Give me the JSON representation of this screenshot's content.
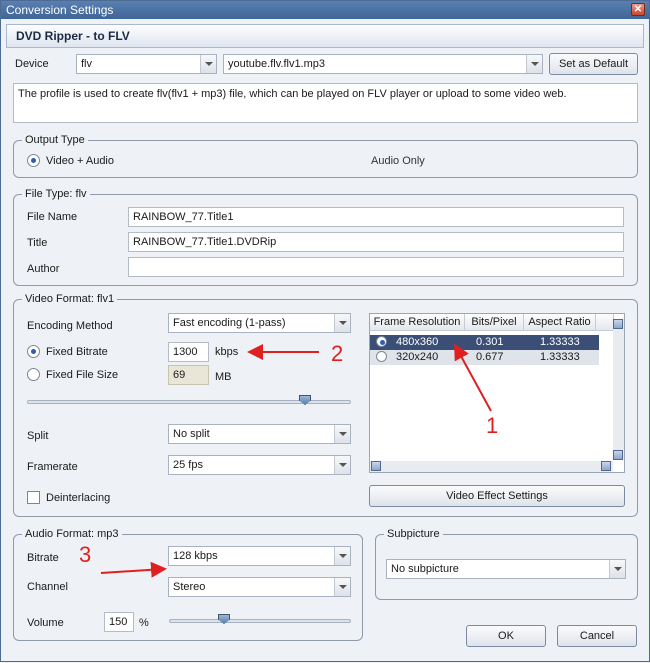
{
  "window": {
    "title": "Conversion Settings",
    "close_glyph": "✕"
  },
  "header": {
    "title": "DVD Ripper - to FLV"
  },
  "device": {
    "label": "Device",
    "device_value": "flv",
    "profile_value": "youtube.flv.flv1.mp3",
    "set_default_label": "Set as Default",
    "description": "The profile is used to create flv(flv1 + mp3) file, which can be played on FLV player or upload to some video web."
  },
  "output_type": {
    "title": "Output Type",
    "video_audio_label": "Video + Audio",
    "audio_only_label": "Audio Only"
  },
  "file_type": {
    "title": "File Type: flv",
    "file_name_label": "File Name",
    "file_name_value": "RAINBOW_77.Title1",
    "title_label": "Title",
    "title_value": "RAINBOW_77.Title1.DVDRip",
    "author_label": "Author",
    "author_value": ""
  },
  "video_format": {
    "title": "Video Format: flv1",
    "encoding_label": "Encoding Method",
    "encoding_value": "Fast encoding (1-pass)",
    "fixed_bitrate_label": "Fixed Bitrate",
    "bitrate_value": "1300",
    "bitrate_unit": "kbps",
    "fixed_size_label": "Fixed File Size",
    "size_value": "69",
    "size_unit": "MB",
    "split_label": "Split",
    "split_value": "No split",
    "framerate_label": "Framerate",
    "framerate_value": "25 fps",
    "deinterlacing_label": "Deinterlacing",
    "video_effect_label": "Video Effect Settings",
    "table": {
      "headers": [
        "Frame Resolution",
        "Bits/Pixel",
        "Aspect Ratio"
      ],
      "rows": [
        {
          "resolution": "480x360",
          "bits": "0.301",
          "aspect": "1.33333"
        },
        {
          "resolution": "320x240",
          "bits": "0.677",
          "aspect": "1.33333"
        }
      ]
    }
  },
  "audio_format": {
    "title": "Audio Format: mp3",
    "bitrate_label": "Bitrate",
    "bitrate_value": "128 kbps",
    "channel_label": "Channel",
    "channel_value": "Stereo",
    "volume_label": "Volume",
    "volume_value": "150",
    "volume_unit": "%"
  },
  "subpicture": {
    "title": "Subpicture",
    "value": "No subpicture"
  },
  "buttons": {
    "ok": "OK",
    "cancel": "Cancel"
  },
  "annotations": {
    "one": "1",
    "two": "2",
    "three": "3"
  },
  "colors": {
    "annotation": "#e02020",
    "selected_row": "#3a4e76",
    "titlebar": "#4a70a4"
  }
}
